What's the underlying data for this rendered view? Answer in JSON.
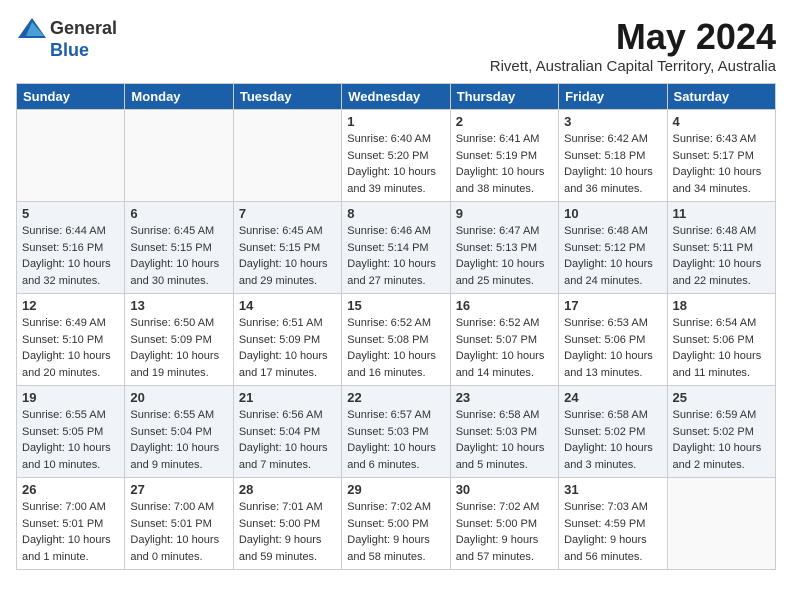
{
  "header": {
    "logo_general": "General",
    "logo_blue": "Blue",
    "month_title": "May 2024",
    "location": "Rivett, Australian Capital Territory, Australia"
  },
  "days_of_week": [
    "Sunday",
    "Monday",
    "Tuesday",
    "Wednesday",
    "Thursday",
    "Friday",
    "Saturday"
  ],
  "weeks": [
    [
      {
        "day": "",
        "sunrise": "",
        "sunset": "",
        "daylight": ""
      },
      {
        "day": "",
        "sunrise": "",
        "sunset": "",
        "daylight": ""
      },
      {
        "day": "",
        "sunrise": "",
        "sunset": "",
        "daylight": ""
      },
      {
        "day": "1",
        "sunrise": "Sunrise: 6:40 AM",
        "sunset": "Sunset: 5:20 PM",
        "daylight": "Daylight: 10 hours and 39 minutes."
      },
      {
        "day": "2",
        "sunrise": "Sunrise: 6:41 AM",
        "sunset": "Sunset: 5:19 PM",
        "daylight": "Daylight: 10 hours and 38 minutes."
      },
      {
        "day": "3",
        "sunrise": "Sunrise: 6:42 AM",
        "sunset": "Sunset: 5:18 PM",
        "daylight": "Daylight: 10 hours and 36 minutes."
      },
      {
        "day": "4",
        "sunrise": "Sunrise: 6:43 AM",
        "sunset": "Sunset: 5:17 PM",
        "daylight": "Daylight: 10 hours and 34 minutes."
      }
    ],
    [
      {
        "day": "5",
        "sunrise": "Sunrise: 6:44 AM",
        "sunset": "Sunset: 5:16 PM",
        "daylight": "Daylight: 10 hours and 32 minutes."
      },
      {
        "day": "6",
        "sunrise": "Sunrise: 6:45 AM",
        "sunset": "Sunset: 5:15 PM",
        "daylight": "Daylight: 10 hours and 30 minutes."
      },
      {
        "day": "7",
        "sunrise": "Sunrise: 6:45 AM",
        "sunset": "Sunset: 5:15 PM",
        "daylight": "Daylight: 10 hours and 29 minutes."
      },
      {
        "day": "8",
        "sunrise": "Sunrise: 6:46 AM",
        "sunset": "Sunset: 5:14 PM",
        "daylight": "Daylight: 10 hours and 27 minutes."
      },
      {
        "day": "9",
        "sunrise": "Sunrise: 6:47 AM",
        "sunset": "Sunset: 5:13 PM",
        "daylight": "Daylight: 10 hours and 25 minutes."
      },
      {
        "day": "10",
        "sunrise": "Sunrise: 6:48 AM",
        "sunset": "Sunset: 5:12 PM",
        "daylight": "Daylight: 10 hours and 24 minutes."
      },
      {
        "day": "11",
        "sunrise": "Sunrise: 6:48 AM",
        "sunset": "Sunset: 5:11 PM",
        "daylight": "Daylight: 10 hours and 22 minutes."
      }
    ],
    [
      {
        "day": "12",
        "sunrise": "Sunrise: 6:49 AM",
        "sunset": "Sunset: 5:10 PM",
        "daylight": "Daylight: 10 hours and 20 minutes."
      },
      {
        "day": "13",
        "sunrise": "Sunrise: 6:50 AM",
        "sunset": "Sunset: 5:09 PM",
        "daylight": "Daylight: 10 hours and 19 minutes."
      },
      {
        "day": "14",
        "sunrise": "Sunrise: 6:51 AM",
        "sunset": "Sunset: 5:09 PM",
        "daylight": "Daylight: 10 hours and 17 minutes."
      },
      {
        "day": "15",
        "sunrise": "Sunrise: 6:52 AM",
        "sunset": "Sunset: 5:08 PM",
        "daylight": "Daylight: 10 hours and 16 minutes."
      },
      {
        "day": "16",
        "sunrise": "Sunrise: 6:52 AM",
        "sunset": "Sunset: 5:07 PM",
        "daylight": "Daylight: 10 hours and 14 minutes."
      },
      {
        "day": "17",
        "sunrise": "Sunrise: 6:53 AM",
        "sunset": "Sunset: 5:06 PM",
        "daylight": "Daylight: 10 hours and 13 minutes."
      },
      {
        "day": "18",
        "sunrise": "Sunrise: 6:54 AM",
        "sunset": "Sunset: 5:06 PM",
        "daylight": "Daylight: 10 hours and 11 minutes."
      }
    ],
    [
      {
        "day": "19",
        "sunrise": "Sunrise: 6:55 AM",
        "sunset": "Sunset: 5:05 PM",
        "daylight": "Daylight: 10 hours and 10 minutes."
      },
      {
        "day": "20",
        "sunrise": "Sunrise: 6:55 AM",
        "sunset": "Sunset: 5:04 PM",
        "daylight": "Daylight: 10 hours and 9 minutes."
      },
      {
        "day": "21",
        "sunrise": "Sunrise: 6:56 AM",
        "sunset": "Sunset: 5:04 PM",
        "daylight": "Daylight: 10 hours and 7 minutes."
      },
      {
        "day": "22",
        "sunrise": "Sunrise: 6:57 AM",
        "sunset": "Sunset: 5:03 PM",
        "daylight": "Daylight: 10 hours and 6 minutes."
      },
      {
        "day": "23",
        "sunrise": "Sunrise: 6:58 AM",
        "sunset": "Sunset: 5:03 PM",
        "daylight": "Daylight: 10 hours and 5 minutes."
      },
      {
        "day": "24",
        "sunrise": "Sunrise: 6:58 AM",
        "sunset": "Sunset: 5:02 PM",
        "daylight": "Daylight: 10 hours and 3 minutes."
      },
      {
        "day": "25",
        "sunrise": "Sunrise: 6:59 AM",
        "sunset": "Sunset: 5:02 PM",
        "daylight": "Daylight: 10 hours and 2 minutes."
      }
    ],
    [
      {
        "day": "26",
        "sunrise": "Sunrise: 7:00 AM",
        "sunset": "Sunset: 5:01 PM",
        "daylight": "Daylight: 10 hours and 1 minute."
      },
      {
        "day": "27",
        "sunrise": "Sunrise: 7:00 AM",
        "sunset": "Sunset: 5:01 PM",
        "daylight": "Daylight: 10 hours and 0 minutes."
      },
      {
        "day": "28",
        "sunrise": "Sunrise: 7:01 AM",
        "sunset": "Sunset: 5:00 PM",
        "daylight": "Daylight: 9 hours and 59 minutes."
      },
      {
        "day": "29",
        "sunrise": "Sunrise: 7:02 AM",
        "sunset": "Sunset: 5:00 PM",
        "daylight": "Daylight: 9 hours and 58 minutes."
      },
      {
        "day": "30",
        "sunrise": "Sunrise: 7:02 AM",
        "sunset": "Sunset: 5:00 PM",
        "daylight": "Daylight: 9 hours and 57 minutes."
      },
      {
        "day": "31",
        "sunrise": "Sunrise: 7:03 AM",
        "sunset": "Sunset: 4:59 PM",
        "daylight": "Daylight: 9 hours and 56 minutes."
      },
      {
        "day": "",
        "sunrise": "",
        "sunset": "",
        "daylight": ""
      }
    ]
  ]
}
